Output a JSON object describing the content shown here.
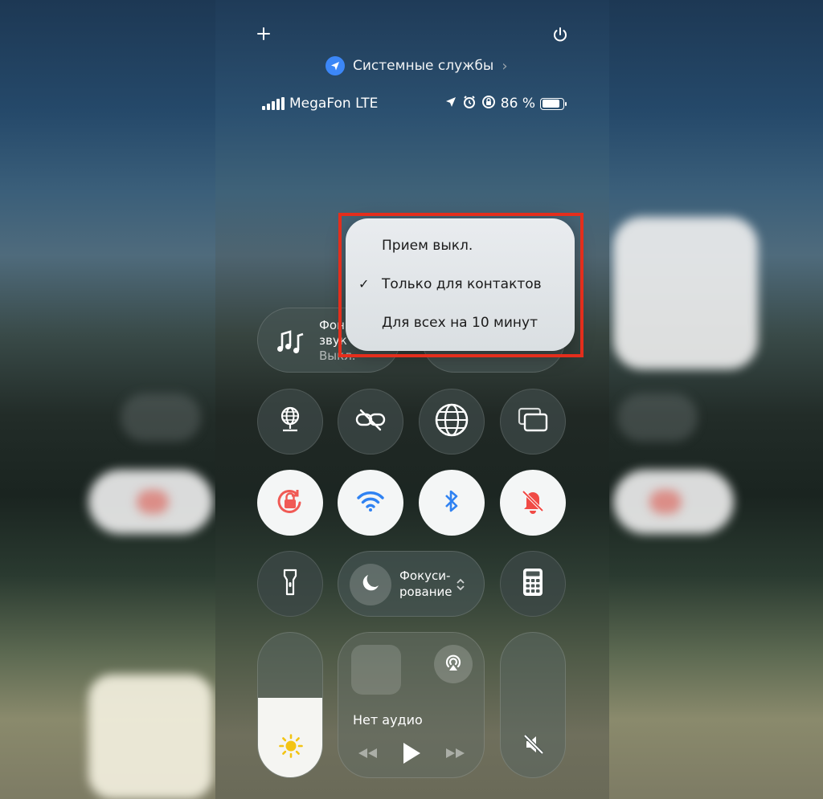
{
  "top": {
    "plus_icon": "plus-icon",
    "power_icon": "power-icon"
  },
  "system_services": {
    "label": "Системные службы",
    "icon": "location-arrow-icon",
    "chevron": "›"
  },
  "status_bar": {
    "carrier": "MegaFon LTE",
    "battery_percent_label": "86 %",
    "battery_level": 0.86
  },
  "airdrop_menu": {
    "options": [
      {
        "label": "Прием выкл.",
        "selected": false
      },
      {
        "label": "Только для контактов",
        "selected": true
      },
      {
        "label": "Для всех на 10 минут",
        "selected": false
      }
    ],
    "check_mark": "✓"
  },
  "background_sounds": {
    "line1": "Фон",
    "line2": "звук",
    "line3": "Выкл."
  },
  "focus": {
    "line1": "Фокуси-",
    "line2": "рование"
  },
  "media": {
    "status": "Нет аудио"
  },
  "colors": {
    "accent_blue": "#3c87f7",
    "highlight_red": "#e42e1c",
    "bell_off_red": "#f04a45",
    "lock_red": "#f05a55",
    "wifi_blue": "#2f82f2",
    "sun_yellow": "#f3c414"
  },
  "brightness_level": 0.55
}
